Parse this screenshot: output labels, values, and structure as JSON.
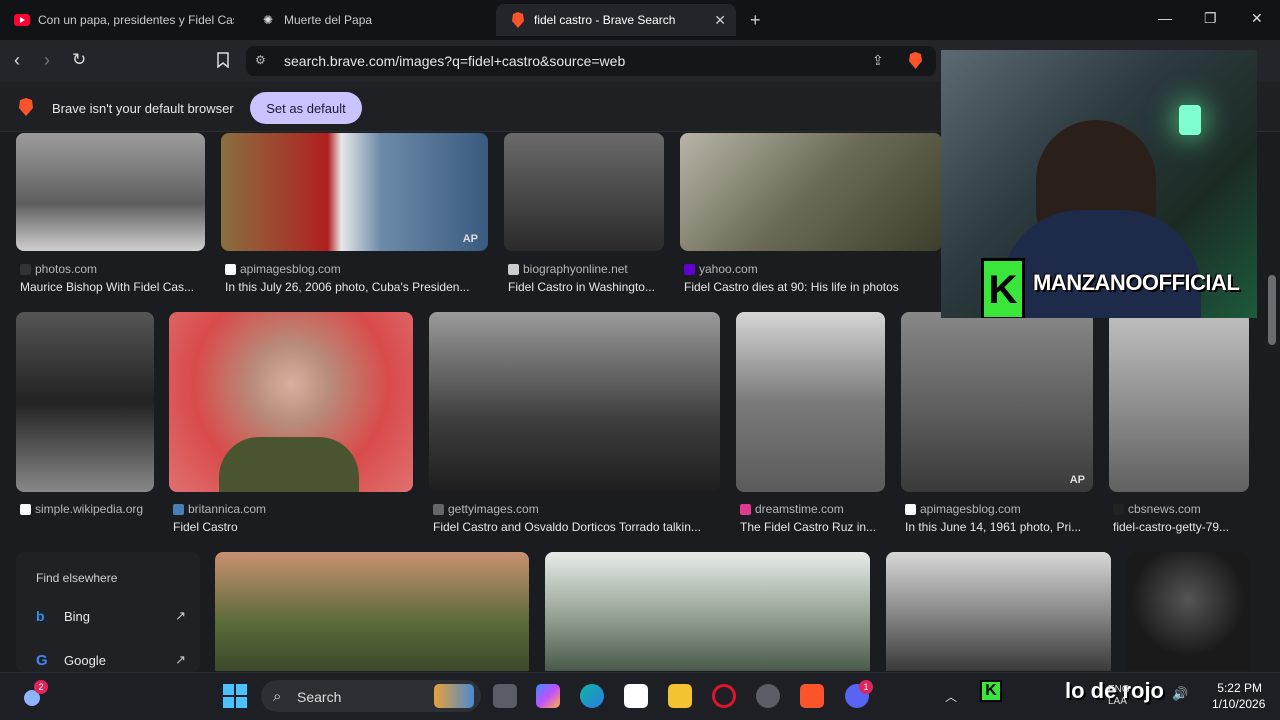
{
  "tabs": [
    {
      "label": "Con un papa, presidentes y Fidel Cas",
      "icon": "youtube-icon"
    },
    {
      "label": "Muerte del Papa",
      "icon": "chatgpt-icon"
    },
    {
      "label": "fidel castro - Brave Search",
      "icon": "brave-icon"
    }
  ],
  "address": {
    "url": "search.brave.com/images?q=fidel+castro&source=web"
  },
  "notification": {
    "text": "Brave isn't your default browser",
    "button": "Set as default"
  },
  "results": [
    {
      "source": "photos.com",
      "caption": "Maurice Bishop With Fidel Cas..."
    },
    {
      "source": "apimagesblog.com",
      "caption": "In this July 26, 2006 photo, Cuba's Presiden..."
    },
    {
      "source": "biographyonline.net",
      "caption": "Fidel Castro in Washingto..."
    },
    {
      "source": "yahoo.com",
      "caption": "Fidel Castro dies at 90: His life in photos"
    },
    {
      "source": "simple.wikipedia.org",
      "caption": ""
    },
    {
      "source": "britannica.com",
      "caption": "Fidel Castro"
    },
    {
      "source": "gettyimages.com",
      "caption": "Fidel Castro and Osvaldo Dorticos Torrado talkin..."
    },
    {
      "source": "dreamstime.com",
      "caption": "The Fidel Castro Ruz in..."
    },
    {
      "source": "apimagesblog.com",
      "caption": "In this June 14, 1961 photo, Pri..."
    },
    {
      "source": "cbsnews.com",
      "caption": "fidel-castro-getty-79..."
    }
  ],
  "elsewhere": {
    "title": "Find elsewhere",
    "items": [
      {
        "label": "Bing"
      },
      {
        "label": "Google"
      }
    ]
  },
  "overlay": {
    "channel": "MANZANOOFFICIAL",
    "ticker": "lo de rojo",
    "badge": "AP"
  },
  "taskbar": {
    "search_placeholder": "Search",
    "time": "5:22 PM",
    "date": "1/10/2026",
    "lang": "ENG",
    "region": "LAA",
    "notif_count": "2",
    "discord_count": "1"
  },
  "colors": {
    "accent": "#c9c4ff",
    "brave": "#fb542b"
  }
}
